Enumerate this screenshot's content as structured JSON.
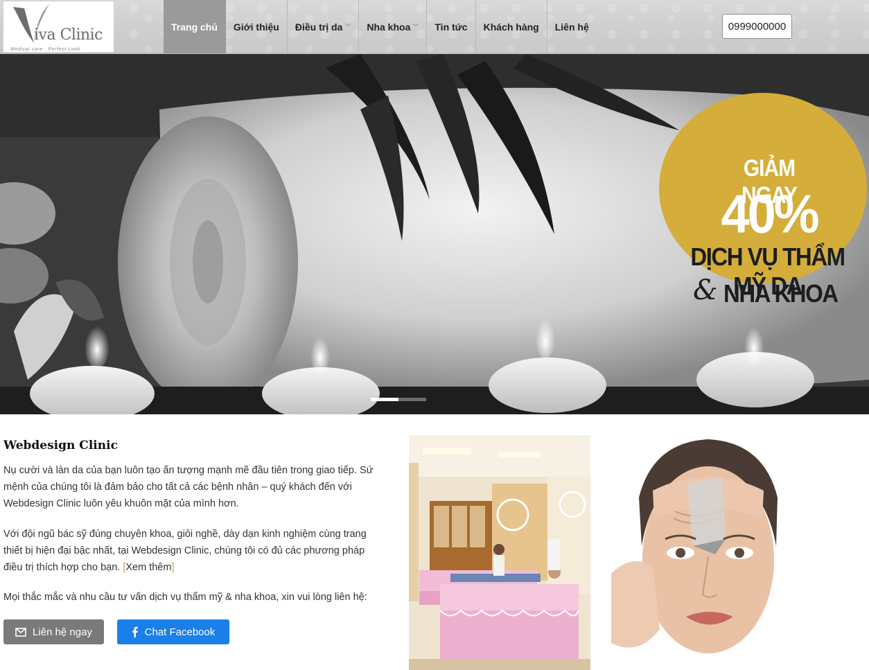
{
  "brand": {
    "name": "Viva Clinic",
    "name_part": "iva Clinic",
    "tagline": "Medical care . Perfect Look"
  },
  "nav": {
    "items": [
      {
        "label": "Trang chủ",
        "active": true,
        "dropdown": false
      },
      {
        "label": "Giới thiệu",
        "active": false,
        "dropdown": false
      },
      {
        "label": "Điều trị da",
        "active": false,
        "dropdown": true
      },
      {
        "label": "Nha khoa",
        "active": false,
        "dropdown": true
      },
      {
        "label": "Tin tức",
        "active": false,
        "dropdown": false
      },
      {
        "label": "Khách hàng",
        "active": false,
        "dropdown": false
      },
      {
        "label": "Liên hệ",
        "active": false,
        "dropdown": false
      }
    ],
    "phone": "0999000000"
  },
  "hero": {
    "promo_line1": "GIẢM NGAY",
    "promo_line2": "40%",
    "promo_line3": "DỊCH VỤ THẨM MỸ DA",
    "promo_amp": "&",
    "promo_line4": "NHA KHOA",
    "slide_count": 3,
    "active_slide": 0,
    "colors": {
      "promo": "#d4ad3a"
    }
  },
  "content": {
    "title": "Webdesign Clinic",
    "para1": "Nụ cười và làn da của bạn luôn tạo ấn tượng mạnh mẽ đầu tiên trong giao tiếp. Sứ mệnh của chúng tôi là đảm bảo cho tất cả các bệnh nhân – quý khách đến với Webdesign Clinic luôn yêu khuôn mặt của mình hơn.",
    "para2": "Với đội ngũ bác sỹ đúng chuyên khoa, giỏi nghề, dày dạn kinh nghiệm cùng trang thiết bị hiện đại bậc nhất, tại Webdesign Clinic, chúng tôi có đủ các phương pháp điều trị thích hợp cho bạn.",
    "more_open": "[",
    "more_label": "Xem thêm",
    "more_close": "]",
    "para3": "Mọi thắc mắc và nhu cầu tư vấn dịch vụ thẩm mỹ & nha khoa, xin vui lòng liên hệ:",
    "contact_button": "Liên hệ ngay",
    "facebook_button": "Chat Facebook",
    "colors": {
      "contact": "#7a7a7a",
      "facebook": "#1a7fe8"
    }
  }
}
